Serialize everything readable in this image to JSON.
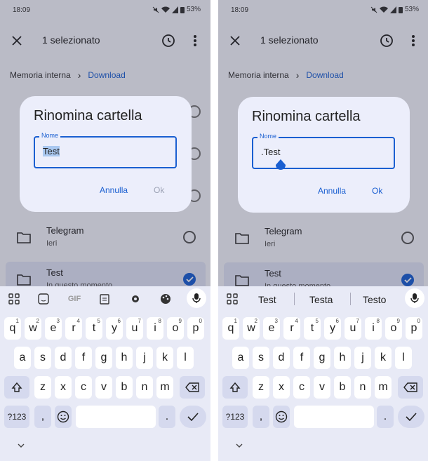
{
  "status": {
    "time": "18:09",
    "battery": "53%"
  },
  "header": {
    "title": "1 selezionato"
  },
  "breadcrumb": {
    "root": "Memoria interna",
    "current": "Download"
  },
  "rows": [
    {
      "name": "Telegram",
      "sub": "Ieri"
    },
    {
      "name": "Test",
      "sub": "In questo momento"
    }
  ],
  "dialog": {
    "title": "Rinomina cartella",
    "field_label": "Nome",
    "value_left": "Test",
    "value_right": ".Test",
    "cancel": "Annulla",
    "ok": "Ok"
  },
  "keyboard": {
    "toolbar_gif": "GIF",
    "suggestions": [
      "Test",
      "Testa",
      "Testo"
    ],
    "row1": [
      "q",
      "w",
      "e",
      "r",
      "t",
      "y",
      "u",
      "i",
      "o",
      "p"
    ],
    "row1_nums": [
      "1",
      "2",
      "3",
      "4",
      "5",
      "6",
      "7",
      "8",
      "9",
      "0"
    ],
    "row2": [
      "a",
      "s",
      "d",
      "f",
      "g",
      "h",
      "j",
      "k",
      "l"
    ],
    "row3": [
      "z",
      "x",
      "c",
      "v",
      "b",
      "n",
      "m"
    ],
    "symbols": "?123",
    "comma": ",",
    "period": "."
  },
  "colors": {
    "accent": "#1a5fd1",
    "dialog_bg": "#eceefb",
    "keyboard_bg": "#e8eaf6"
  },
  "icons": [
    "close-icon",
    "history-icon",
    "more-vert-icon",
    "folder-icon",
    "check-icon",
    "mic-icon",
    "grid-icon",
    "sticker-icon",
    "clipboard-icon",
    "gear-icon",
    "palette-icon",
    "shift-icon",
    "backspace-icon",
    "emoji-icon",
    "enter-icon",
    "chevron-down-icon",
    "wifi-icon",
    "mute-icon",
    "battery-icon"
  ]
}
